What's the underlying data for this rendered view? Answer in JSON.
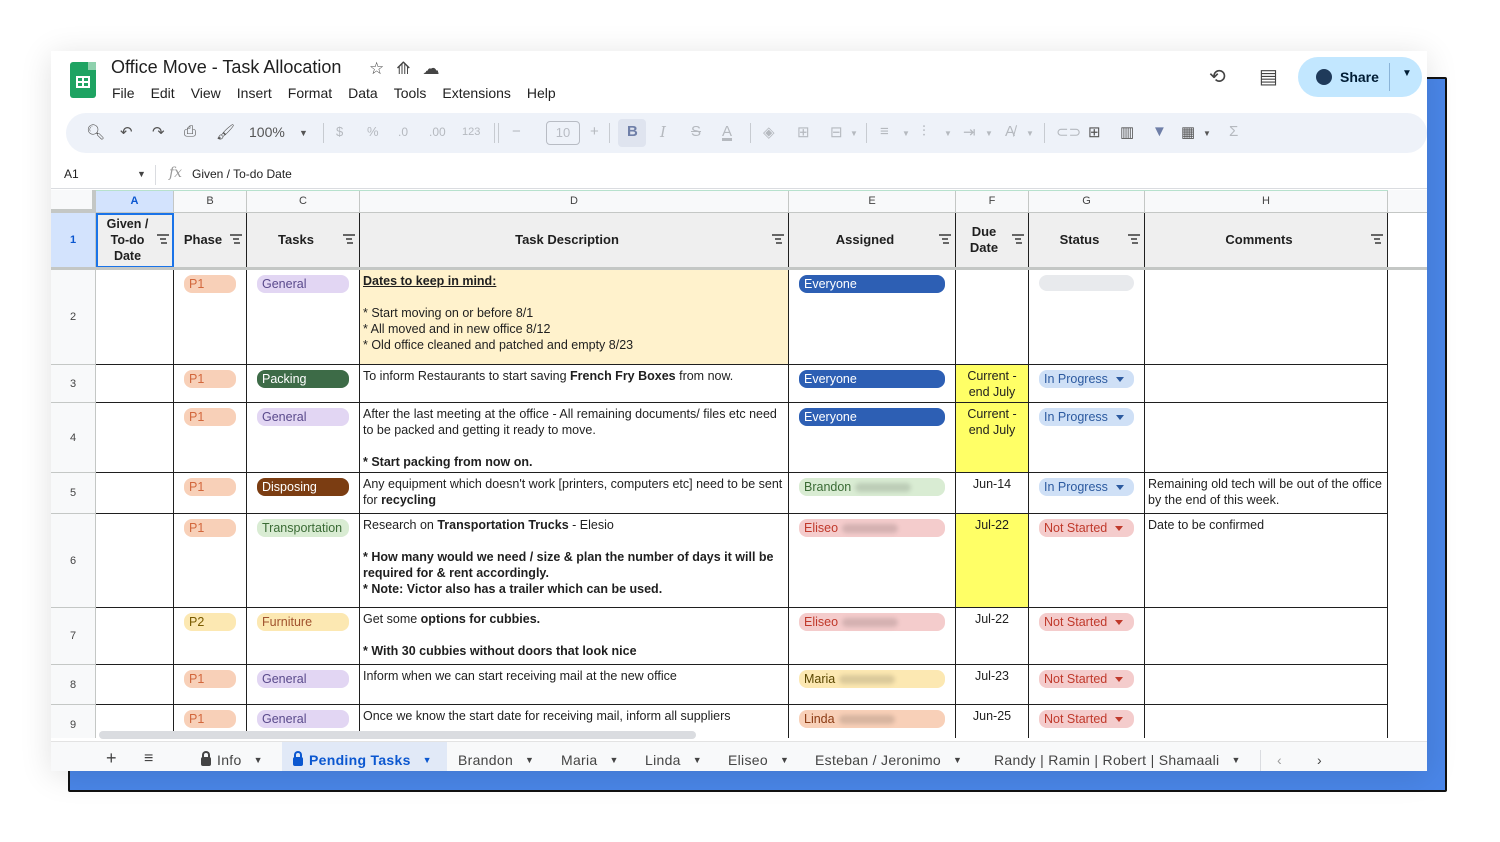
{
  "app": {
    "title": "Office Move - Task Allocation",
    "menu": [
      "File",
      "Edit",
      "View",
      "Insert",
      "Format",
      "Data",
      "Tools",
      "Extensions",
      "Help"
    ],
    "share_label": "Share"
  },
  "toolbar": {
    "zoom": "100%",
    "currency": "$",
    "percent": "%",
    "dec_decrease": ".0",
    "dec_increase": ".00",
    "number_format": "123",
    "font_size": "10",
    "bold": "B",
    "italic": "I",
    "text_color": "A",
    "sum": "Σ"
  },
  "formula_bar": {
    "cell_ref": "A1",
    "fx": "fx",
    "content": "Given / To-do Date"
  },
  "columns": [
    "A",
    "B",
    "C",
    "D",
    "E",
    "F",
    "G",
    "H"
  ],
  "headers": {
    "a": "Given / To-do Date",
    "b": "Phase",
    "c": "Tasks",
    "d": "Task Description",
    "e": "Assigned",
    "f": "Due Date",
    "g": "Status",
    "h": "Comments"
  },
  "rows": [
    {
      "num": "1"
    },
    {
      "num": "2",
      "phase": "P1",
      "task": "General",
      "desc_title": "Dates to keep in mind:",
      "desc_lines": [
        "* Start moving on or before 8/1",
        "* All moved and in new office 8/12",
        "* Old office cleaned and patched and empty 8/23"
      ],
      "assigned": "Everyone"
    },
    {
      "num": "3",
      "phase": "P1",
      "task": "Packing",
      "desc_pre": "To inform Restaurants to start saving ",
      "desc_bold": "French Fry Boxes",
      "desc_post": " from now.",
      "assigned": "Everyone",
      "due": "Current - end July",
      "status": "In Progress"
    },
    {
      "num": "4",
      "phase": "P1",
      "task": "General",
      "desc_text": "After the last meeting at the office - All remaining documents/ files etc need to be packed and getting it ready to move.",
      "desc_bold2": "* Start packing from now on.",
      "assigned": "Everyone",
      "due": "Current - end July",
      "status": "In Progress"
    },
    {
      "num": "5",
      "phase": "P1",
      "task": "Disposing",
      "desc_pre": "Any equipment which doesn't work [printers, computers etc] need to be sent for ",
      "desc_bold": "recycling",
      "assigned": "Brandon",
      "due": "Jun-14",
      "status": "In Progress",
      "comment": "Remaining old tech will be out of the office by the end of this week."
    },
    {
      "num": "6",
      "phase": "P1",
      "task": "Transportation",
      "desc_pre": "Research on ",
      "desc_bold": "Transportation Trucks",
      "desc_post": " - Elesio",
      "desc_bold_lines": [
        "* How many would we need / size & plan the number of days it will be required for & rent accordingly.",
        "* Note: Victor also has a trailer which can be used."
      ],
      "assigned": "Eliseo",
      "due": "Jul-22",
      "status": "Not Started",
      "comment": "Date to be confirmed"
    },
    {
      "num": "7",
      "phase": "P2",
      "task": "Furniture",
      "desc_pre": "Get some ",
      "desc_bold": "options for cubbies.",
      "desc_bold2": "* With 30 cubbies without doors that look nice",
      "assigned": "Eliseo",
      "due": "Jul-22",
      "status": "Not Started"
    },
    {
      "num": "8",
      "phase": "P1",
      "task": "General",
      "desc_text": "Inform when we can start receiving mail at the new office",
      "assigned": "Maria",
      "due": "Jul-23",
      "status": "Not Started"
    },
    {
      "num": "9",
      "phase": "P1",
      "task": "General",
      "desc_text": "Once we know the start date for receiving mail, inform all suppliers",
      "assigned": "Linda",
      "due": "Jun-25",
      "status": "Not Started"
    }
  ],
  "sheet_tabs": [
    "Info",
    "Pending Tasks",
    "Brandon",
    "Maria",
    "Linda",
    "Eliseo",
    "Esteban / Jeronimo",
    "Randy | Ramin | Robert | Shamaali"
  ],
  "active_tab": "Pending Tasks",
  "colors": {
    "accent": "#0b57d0",
    "frame_blue": "#4a86e8",
    "highlight_yellow": "#ffff66",
    "note_cream": "#fff2cc"
  }
}
